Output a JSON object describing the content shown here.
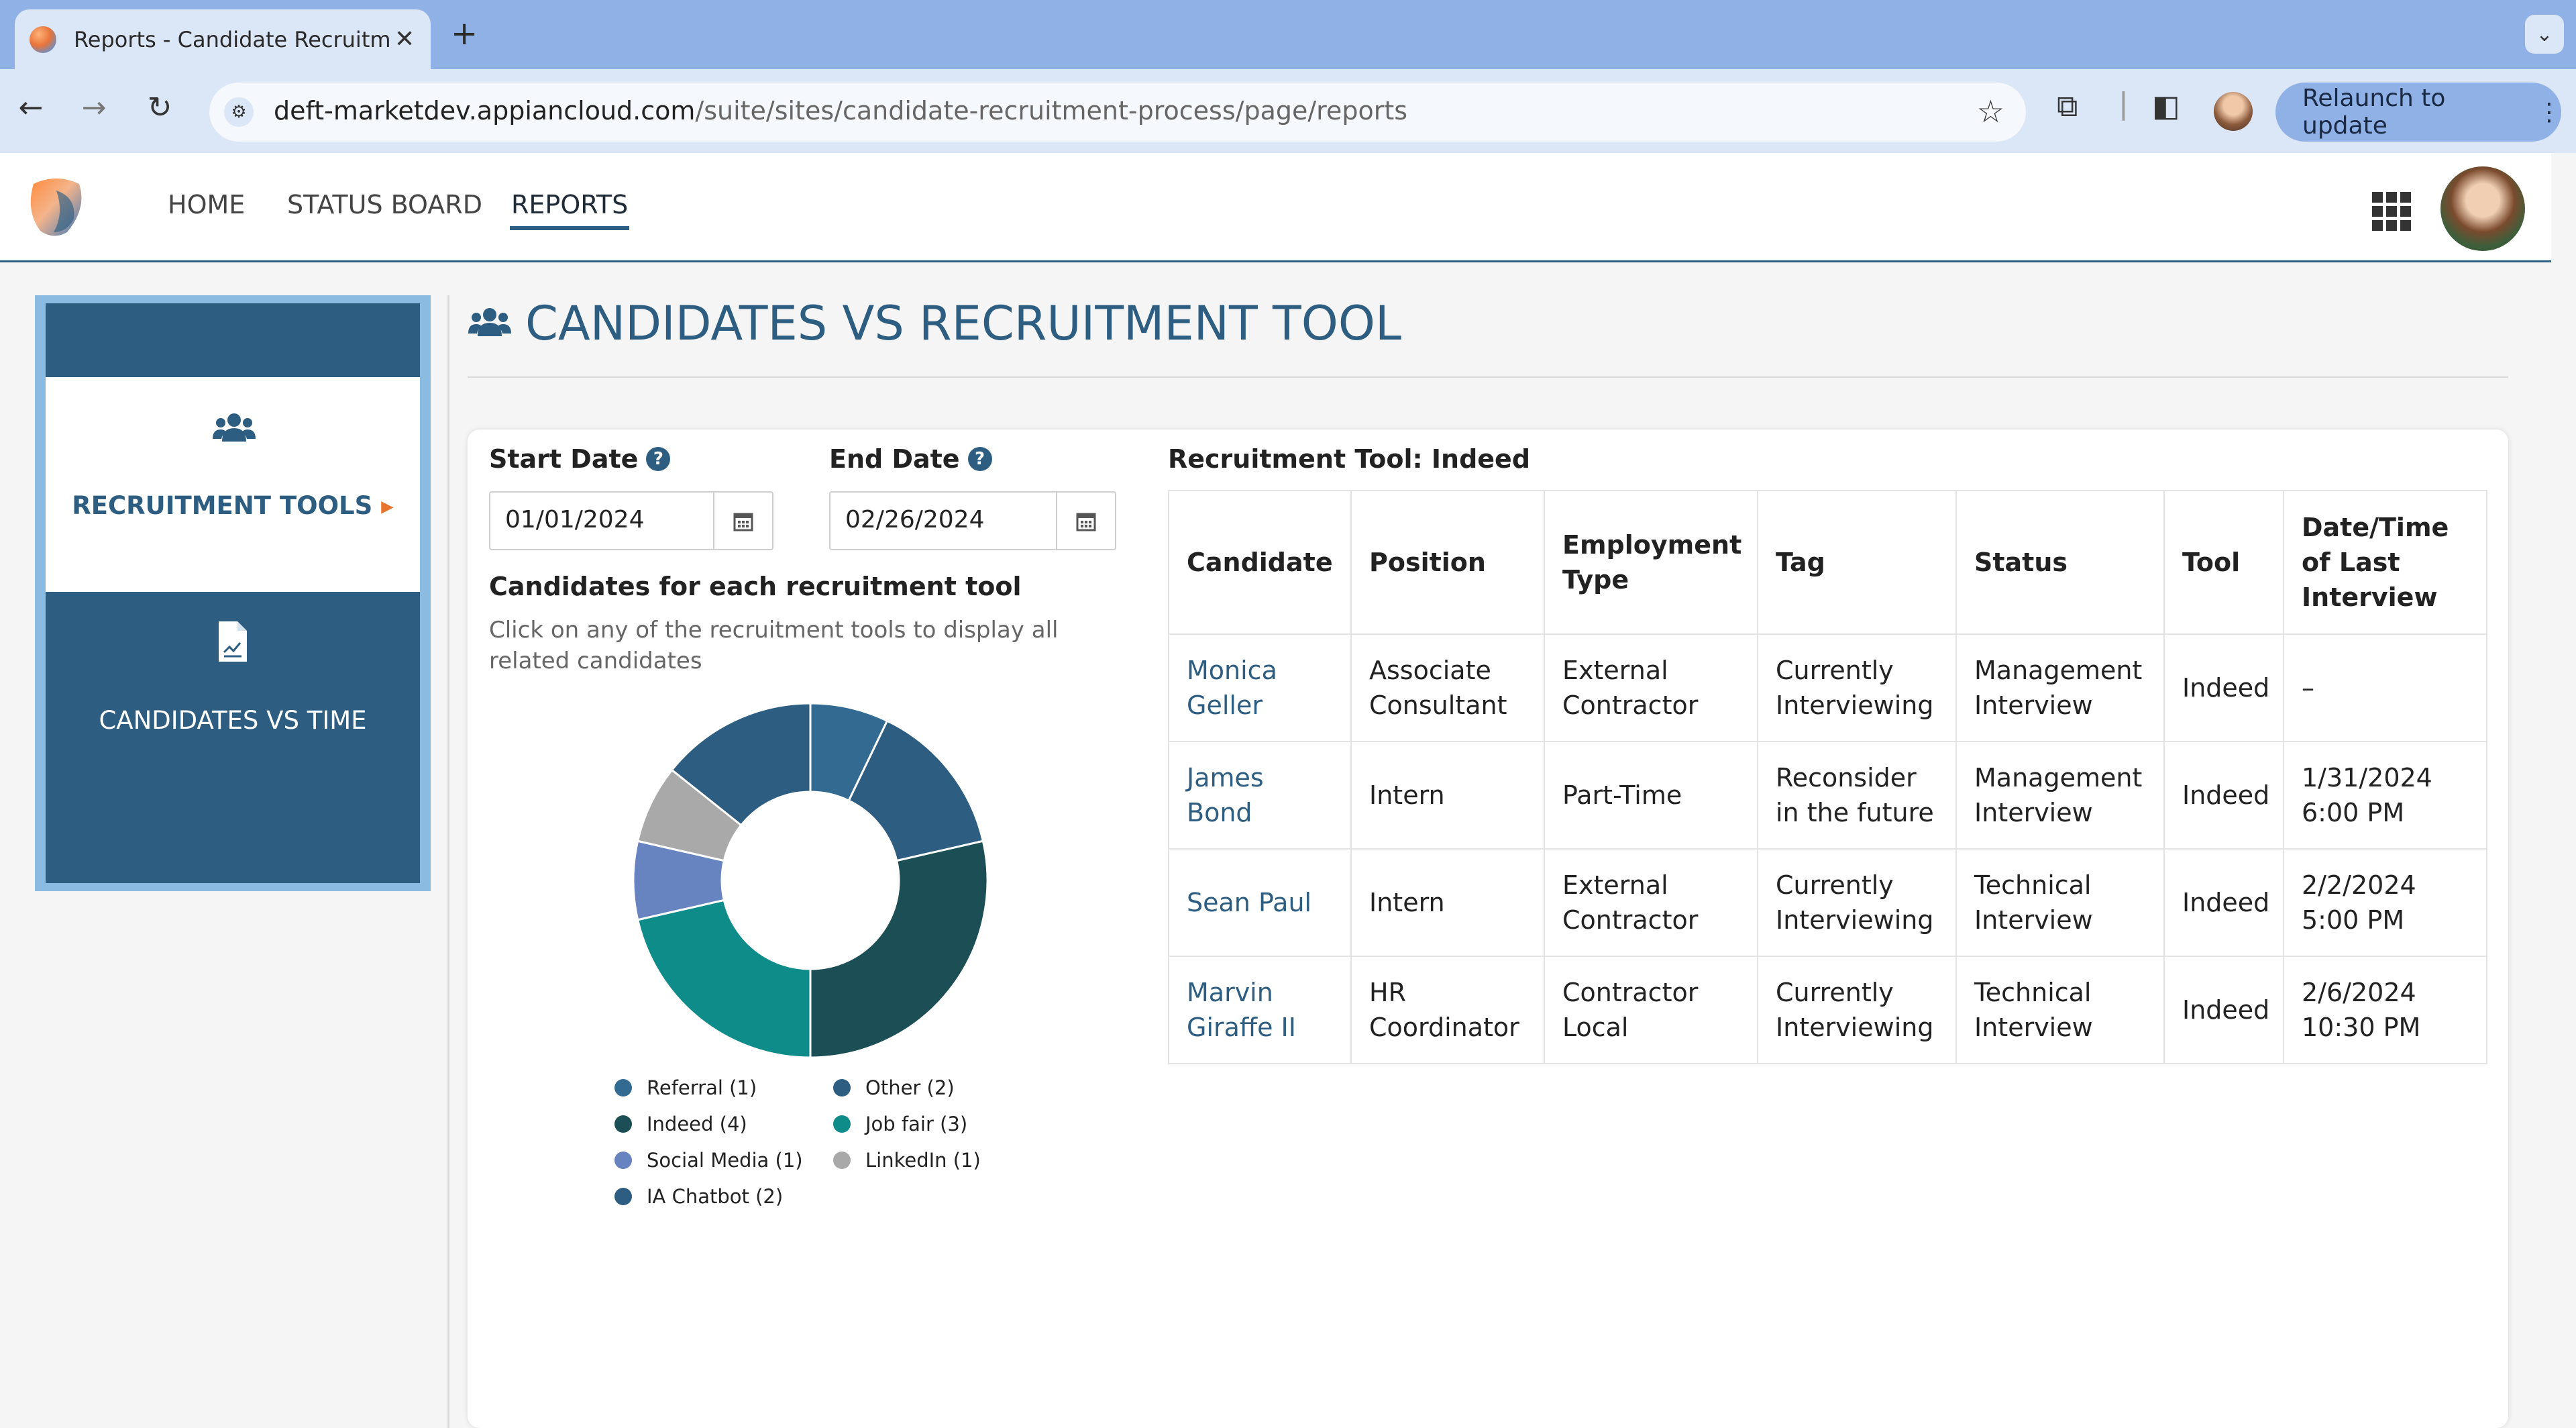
{
  "browser": {
    "tab_title": "Reports - Candidate Recruitm",
    "url_host": "deft-marketdev.appiancloud.com",
    "url_path": "/suite/sites/candidate-recruitment-process/page/reports",
    "relaunch_label": "Relaunch to update"
  },
  "nav": {
    "home": "HOME",
    "status_board": "STATUS BOARD",
    "reports": "REPORTS"
  },
  "sidebar": {
    "items": [
      {
        "label": "RECRUITMENT TOOLS",
        "icon": "users-icon",
        "active": true
      },
      {
        "label": "CANDIDATES VS TIME",
        "icon": "document-chart-icon",
        "active": false
      }
    ]
  },
  "page": {
    "title": "CANDIDATES VS RECRUITMENT TOOL"
  },
  "filters": {
    "start_label": "Start Date",
    "start_value": "01/01/2024",
    "end_label": "End Date",
    "end_value": "02/26/2024"
  },
  "chart_section": {
    "heading": "Candidates for each recruitment tool",
    "instruction": "Click on any of the recruitment tools to display all related candidates"
  },
  "chart_data": {
    "type": "pie",
    "donut": true,
    "slices": [
      {
        "label": "Referral (1)",
        "value": 1,
        "color": "#336a91"
      },
      {
        "label": "Other (2)",
        "value": 2,
        "color": "#2d5e82"
      },
      {
        "label": "Indeed (4)",
        "value": 4,
        "color": "#1b4f55"
      },
      {
        "label": "Job fair (3)",
        "value": 3,
        "color": "#0d8c8a"
      },
      {
        "label": "Social Media (1)",
        "value": 1,
        "color": "#6783c0"
      },
      {
        "label": "LinkedIn (1)",
        "value": 1,
        "color": "#a9a9a9"
      },
      {
        "label": "IA Chatbot (2)",
        "value": 2,
        "color": "#2d5e82"
      }
    ]
  },
  "legend": [
    {
      "label": "Referral (1)",
      "color": "#336a91"
    },
    {
      "label": "Other (2)",
      "color": "#2d5e82"
    },
    {
      "label": "Indeed (4)",
      "color": "#1b4f55"
    },
    {
      "label": "Job fair (3)",
      "color": "#0d8c8a"
    },
    {
      "label": "Social Media (1)",
      "color": "#6783c0"
    },
    {
      "label": "LinkedIn (1)",
      "color": "#a9a9a9"
    },
    {
      "label": "IA Chatbot (2)",
      "color": "#2d5e82"
    }
  ],
  "table": {
    "heading": "Recruitment Tool: Indeed",
    "columns": [
      "Candidate",
      "Position",
      "Employment Type",
      "Tag",
      "Status",
      "Tool",
      "Date/Time of Last Interview"
    ],
    "rows": [
      [
        "Monica Geller",
        "Associate Consultant",
        "External Contractor",
        "Currently Interviewing",
        "Management Interview",
        "Indeed",
        "–"
      ],
      [
        "James Bond",
        "Intern",
        "Part-Time",
        "Reconsider in the future",
        "Management Interview",
        "Indeed",
        "1/31/2024 6:00 PM"
      ],
      [
        "Sean Paul",
        "Intern",
        "External Contractor",
        "Currently Interviewing",
        "Technical Interview",
        "Indeed",
        "2/2/2024 5:00 PM"
      ],
      [
        "Marvin Giraffe II",
        "HR Coordinator",
        "Contractor Local",
        "Currently Interviewing",
        "Technical Interview",
        "Indeed",
        "2/6/2024 10:30 PM"
      ]
    ]
  },
  "colors": {
    "brand": "#2d5e82",
    "accent": "#e8742d",
    "sidebar_frame": "#8bbbe0"
  }
}
